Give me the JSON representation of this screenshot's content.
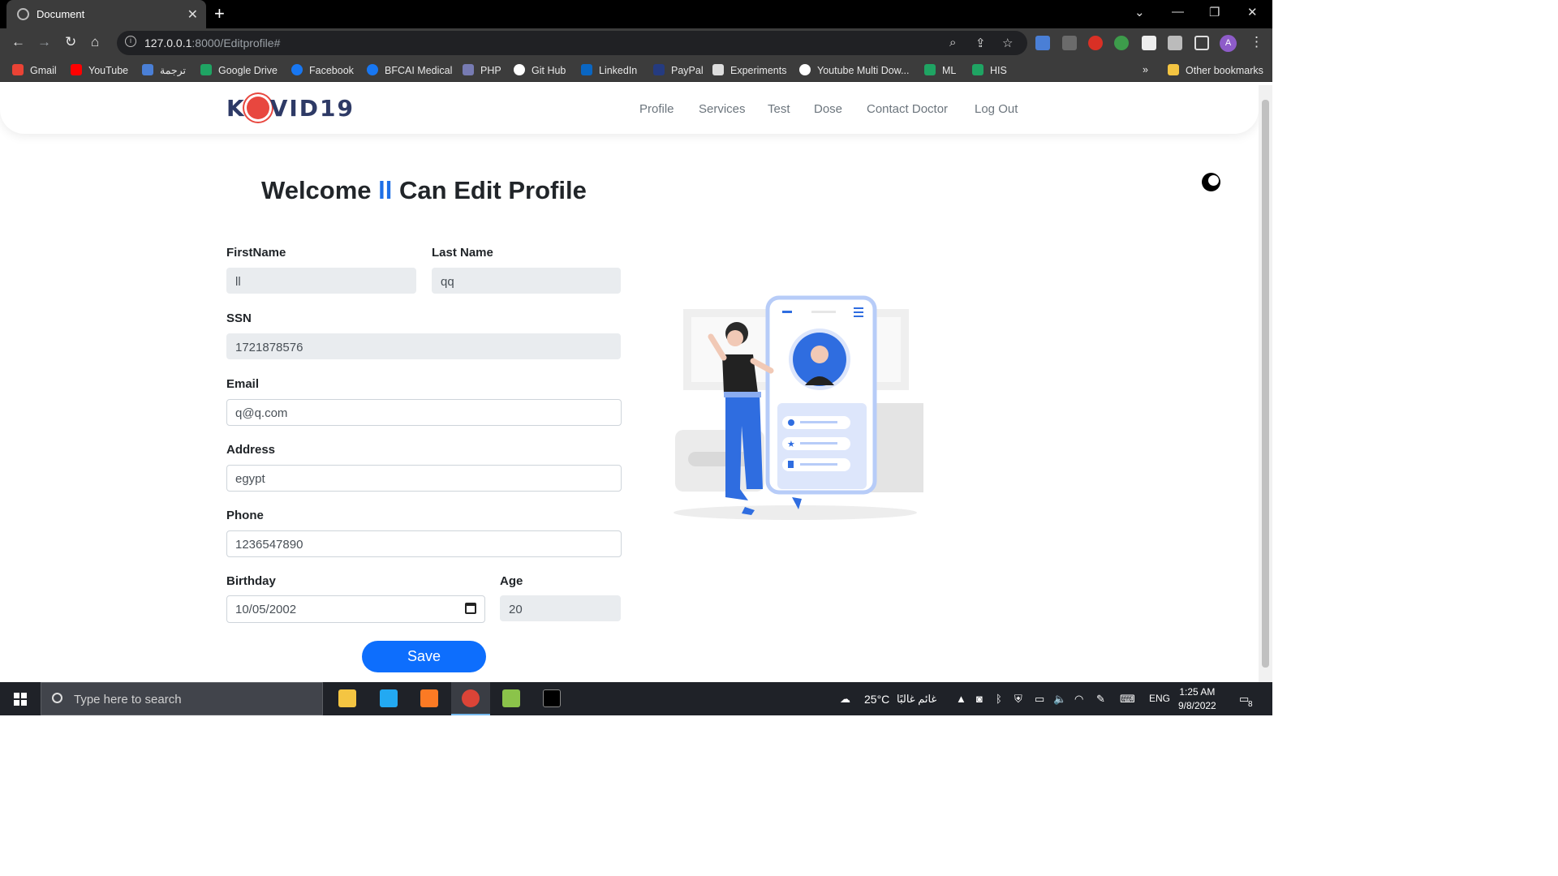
{
  "browser": {
    "tab_title": "Document",
    "url_host": "127.0.0.1",
    "url_rest": ":8000/Editprofile#",
    "bookmarks": [
      "Gmail",
      "YouTube",
      "ترجمة",
      "Google Drive",
      "Facebook",
      "BFCAI Medical",
      "PHP",
      "Git Hub",
      "LinkedIn",
      "PayPal",
      "Experiments",
      "Youtube Multi Dow...",
      "ML",
      "HIS"
    ],
    "other_bookmarks": "Other bookmarks",
    "profile_initial": "A"
  },
  "site": {
    "logo_left": "K",
    "logo_right": "VID19",
    "nav": [
      "Profile",
      "Services",
      "Test",
      "Dose",
      "Contact Doctor",
      "Log Out"
    ]
  },
  "form": {
    "heading_start": "Welcome",
    "heading_name": "ll",
    "heading_end": "Can Edit Profile",
    "first_name_label": "FirstName",
    "first_name_value": "ll",
    "last_name_label": "Last Name",
    "last_name_value": "qq",
    "ssn_label": "SSN",
    "ssn_value": "1721878576",
    "email_label": "Email",
    "email_value": "q@q.com",
    "address_label": "Address",
    "address_value": "egypt",
    "phone_label": "Phone",
    "phone_value": "1236547890",
    "birthday_label": "Birthday",
    "birthday_value": "10/05/2002",
    "age_label": "Age",
    "age_value": "20",
    "save_label": "Save"
  },
  "taskbar": {
    "search_placeholder": "Type here to search",
    "weather": "25°C",
    "weather_text": "غائم غالبًا",
    "language": "ENG",
    "time": "1:25 AM",
    "date": "9/8/2022",
    "notifications": "8"
  },
  "colors": {
    "accent": "#0d6efd",
    "heading_name": "#1e6fe6",
    "logo": "#2e3a66",
    "virus": "#e8473f"
  }
}
